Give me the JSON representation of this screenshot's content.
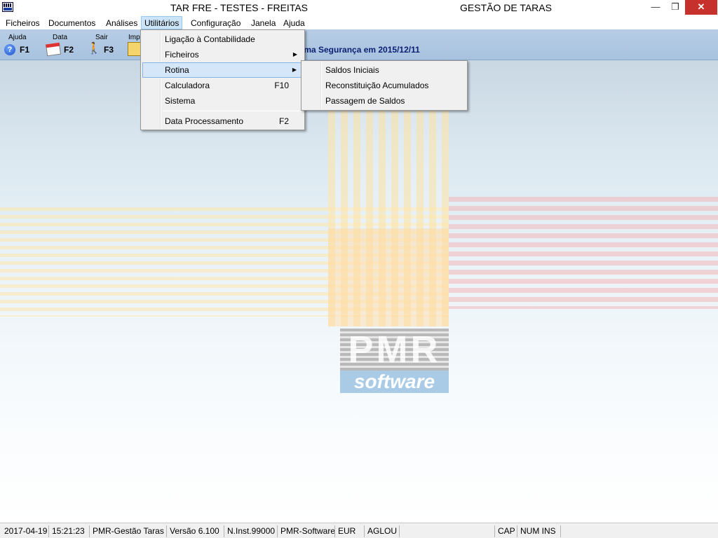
{
  "title_bar": {
    "app_title": "TAR FRE - TESTES - FREITAS",
    "module_title": "GESTÃO DE TARAS",
    "minimize_glyph": "—",
    "maximize_glyph": "❐",
    "close_glyph": "✕"
  },
  "menu_bar": {
    "items": [
      "Ficheiros",
      "Documentos",
      "Análises",
      "Utilitários",
      "Configuração",
      "Janela",
      "Ajuda"
    ],
    "active": "Utilitários"
  },
  "toolbar": {
    "tools": [
      {
        "label": "Ajuda",
        "key": "F1",
        "icon": "help-icon"
      },
      {
        "label": "Data",
        "key": "F2",
        "icon": "calendar-icon"
      },
      {
        "label": "Sair",
        "key": "F3",
        "icon": "exit-icon"
      },
      {
        "label": "Imp",
        "key": "",
        "icon": "print-icon"
      }
    ],
    "security_text": "tima Segurança em  2015/12/11"
  },
  "utilitarios_menu": {
    "items": [
      {
        "label": "Ligação à Contabilidade",
        "shortcut": "",
        "submenu": false
      },
      {
        "label": "Ficheiros",
        "shortcut": "",
        "submenu": true
      },
      {
        "label": "Rotina",
        "shortcut": "",
        "submenu": true,
        "highlighted": true
      },
      {
        "label": "Calculadora",
        "shortcut": "F10",
        "submenu": false
      },
      {
        "label": "Sistema",
        "shortcut": "",
        "submenu": false
      },
      {
        "label": "Data Processamento",
        "shortcut": "F2",
        "submenu": false
      }
    ]
  },
  "rotina_submenu": {
    "items": [
      "Saldos Iniciais",
      "Reconstituição Acumulados",
      "Passagem de Saldos"
    ]
  },
  "logo": {
    "top": "PMR",
    "bottom": "software"
  },
  "status_bar": {
    "date": "2017-04-19",
    "time": "15:21:23",
    "product": "PMR-Gestão Taras",
    "version": "Versão  6.100",
    "installation": "N.Inst.99000",
    "vendor": "PMR-Software",
    "currency": "EUR",
    "user": "AGLOU",
    "blank": "",
    "caps": "CAP",
    "num_ins": "NUM INS"
  },
  "colors": {
    "toolbar_bg": "#b7cde5",
    "menu_highlight": "#d5e6f8",
    "security_text": "#0a1f73",
    "close_button": "#c7312b"
  }
}
